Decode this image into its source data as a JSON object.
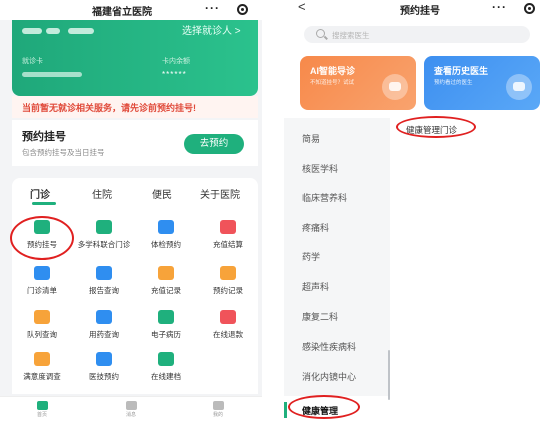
{
  "left_screen": {
    "hospital_title": "福建省立医院",
    "more_icon": "···",
    "card": {
      "select_patient": "选择就诊人 >",
      "card_label": "就诊卡",
      "balance_label": "卡内余额",
      "balance_masked": "******"
    },
    "notice": "当前暂无就诊相关服务，请先诊前预约挂号!",
    "appointment": {
      "title": "预约挂号",
      "subtitle": "包含预约挂号及当日挂号",
      "button": "去预约"
    },
    "tabs": [
      {
        "label": "门诊"
      },
      {
        "label": "住院"
      },
      {
        "label": "便民"
      },
      {
        "label": "关于医院"
      }
    ],
    "services": [
      {
        "label": "预约挂号",
        "icon": "calendar-check-icon",
        "color": "#1fb07d"
      },
      {
        "label": "多学科联合门诊",
        "icon": "calendar-check-icon",
        "color": "#1fb07d"
      },
      {
        "label": "体检预约",
        "icon": "clipboard-icon",
        "color": "#2f8ef0"
      },
      {
        "label": "充值结算",
        "icon": "wallet-icon",
        "color": "#f0535a"
      },
      {
        "label": "门诊清单",
        "icon": "document-icon",
        "color": "#2f8ef0"
      },
      {
        "label": "报告查询",
        "icon": "chart-icon",
        "color": "#2f8ef0"
      },
      {
        "label": "充值记录",
        "icon": "folder-icon",
        "color": "#f7a33a"
      },
      {
        "label": "预约记录",
        "icon": "folder-icon",
        "color": "#f7a33a"
      },
      {
        "label": "队列查询",
        "icon": "hourglass-icon",
        "color": "#f7a33a"
      },
      {
        "label": "用药查询",
        "icon": "pill-icon",
        "color": "#2f8ef0"
      },
      {
        "label": "电子病历",
        "icon": "record-icon",
        "color": "#1fb07d"
      },
      {
        "label": "在线退款",
        "icon": "refund-icon",
        "color": "#f0535a"
      },
      {
        "label": "满意度调查",
        "icon": "survey-icon",
        "color": "#f7a33a"
      },
      {
        "label": "医技预约",
        "icon": "medical-icon",
        "color": "#2f8ef0"
      },
      {
        "label": "在线建档",
        "icon": "profile-icon",
        "color": "#1fb07d"
      }
    ],
    "bottom_nav": [
      {
        "label": "首页",
        "icon": "home-icon",
        "color": "#1fb07d"
      },
      {
        "label": "消息",
        "icon": "message-icon",
        "color": "#bbbbbb"
      },
      {
        "label": "我的",
        "icon": "user-icon",
        "color": "#bbbbbb"
      }
    ]
  },
  "right_screen": {
    "back_icon": "<",
    "title": "预约挂号",
    "more_icon": "···",
    "search_placeholder": "搜搜索医生",
    "promos": [
      {
        "title": "AI智能导诊",
        "subtitle": "不知道挂号？试试",
        "color": "#f7894a"
      },
      {
        "title": "查看历史医生",
        "subtitle": "预约看过的医生",
        "color": "#3d8ff0"
      }
    ],
    "departments": [
      {
        "label": "简易"
      },
      {
        "label": "核医学科"
      },
      {
        "label": "临床营养科"
      },
      {
        "label": "疼痛科"
      },
      {
        "label": "药学"
      },
      {
        "label": "超声科"
      },
      {
        "label": "康复二科"
      },
      {
        "label": "感染性疾病科"
      },
      {
        "label": "消化内镜中心"
      },
      {
        "label": "健康管理"
      }
    ],
    "sub_department": "健康管理门诊"
  }
}
